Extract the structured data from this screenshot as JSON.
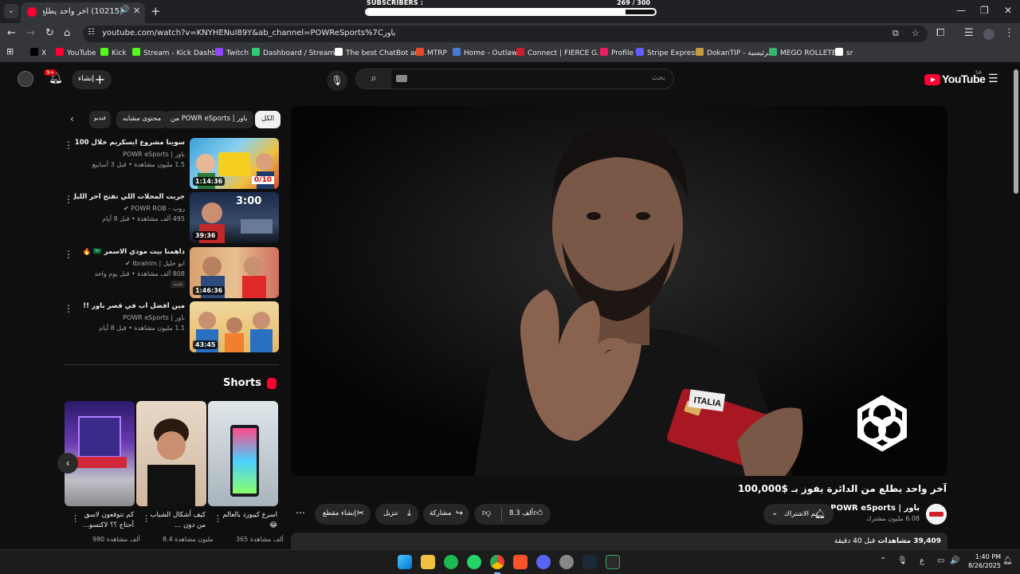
{
  "overlay": {
    "label": "SUBSCRIBERS :",
    "count": "269 / 300",
    "progress": 0.8967
  },
  "browser": {
    "tab_title": "(10215) آخر واحد يطلع من ال",
    "url": "youtube.com/watch?v=KNYHENuI89Y&ab_channel=POWReSports%7Cباور",
    "bookmarks": [
      {
        "label": "X",
        "color": "#000000"
      },
      {
        "label": "YouTube",
        "color": "#ff0033"
      },
      {
        "label": "Kick",
        "color": "#53fc18"
      },
      {
        "label": "Stream - Kick Dashb...",
        "color": "#53fc18"
      },
      {
        "label": "Twitch",
        "color": "#9146ff"
      },
      {
        "label": "Dashboard / Stream...",
        "color": "#2ecc71"
      },
      {
        "label": "The best ChatBot an...",
        "color": "#ffffff"
      },
      {
        "label": "MTRP",
        "color": "#e84a2a"
      },
      {
        "label": "Home - Outlaw",
        "color": "#4a7ad8"
      },
      {
        "label": "Connect | FIERCE G...",
        "color": "#d01e2d"
      },
      {
        "label": "Profile",
        "color": "#e91e63"
      },
      {
        "label": "Stripe Express",
        "color": "#635bff"
      },
      {
        "label": "DokanTIP - الرئيسية",
        "color": "#c49a3a"
      },
      {
        "label": "MEGO ROLLETE",
        "color": "#3cb371"
      },
      {
        "label": "sr",
        "color": "#ffffff"
      }
    ]
  },
  "header": {
    "create_label": "إنشاء",
    "notif_badge": "9+",
    "search_placeholder": "بحث",
    "logo_text": "YouTube",
    "logo_region": "SA"
  },
  "chips": [
    "الكل",
    "من POWR eSports | باور",
    "محتوى مشابه",
    "فيديو"
  ],
  "related": [
    {
      "title": "سوينا مشروع ايسكريم خلال 100 ساعة !!",
      "channel": "باور | POWR eSports",
      "meta": "1.5 مليون مشاهدة • قبل 3 أسابيع",
      "duration": "1:14:36",
      "verified": false,
      "badge": ""
    },
    {
      "title": "جربت المحلات اللي تفتح آخر الليل !",
      "channel": "روب - POWR ROB",
      "meta": "495 ألف مشاهدة • قبل 8 أيام",
      "duration": "39:36",
      "verified": true,
      "badge": ""
    },
    {
      "title": "داهمنا بيت مودي الاسمر 🇸🇦 🔥",
      "channel": "ابو خليل | Ibrahim",
      "meta": "808 ألف مشاهدة • قبل يوم واحد",
      "duration": "1:46:36",
      "verified": true,
      "badge": "جديد"
    },
    {
      "title": "مين أفضل أب في قصر باور !!",
      "channel": "باور | POWR eSports",
      "meta": "1.1 مليون مشاهدة • قبل 8 أيام",
      "duration": "43:45",
      "verified": false,
      "badge": ""
    }
  ],
  "shorts": {
    "heading": "Shorts",
    "items": [
      {
        "title": "كم تتوقعون لاسق أحتاج ؟؟ لاكتسو...",
        "views": "980 ألف مشاهدة"
      },
      {
        "title": "كيف أشكال الشباب من دون ...",
        "views": "8.4 مليون مشاهدة"
      },
      {
        "title": "اسرع كيبورد بالعالم 😂",
        "views": "365 ألف مشاهدة"
      }
    ]
  },
  "video": {
    "title": "آخر واحد يطلع من الدائرة يفوز بـ $100,000",
    "thumb_text_1": "3:00",
    "thumb_text_2": "0/10",
    "channel_name": "باور | POWR eSports",
    "channel_subs": "6.08 مليون مشترك",
    "subscribed_label": "تم الاشتراك",
    "likes": "8.3 ألف",
    "share_label": "مشاركة",
    "download_label": "تنزيل",
    "clip_label": "إنشاء مقطع",
    "views": "39,409 مشاهدات",
    "time_ago": "قبل 40 دقيقة",
    "card_text": "ITALIA"
  },
  "taskbar": {
    "time": "1:40 PM",
    "date": "8/26/2025",
    "lang": "ع"
  }
}
